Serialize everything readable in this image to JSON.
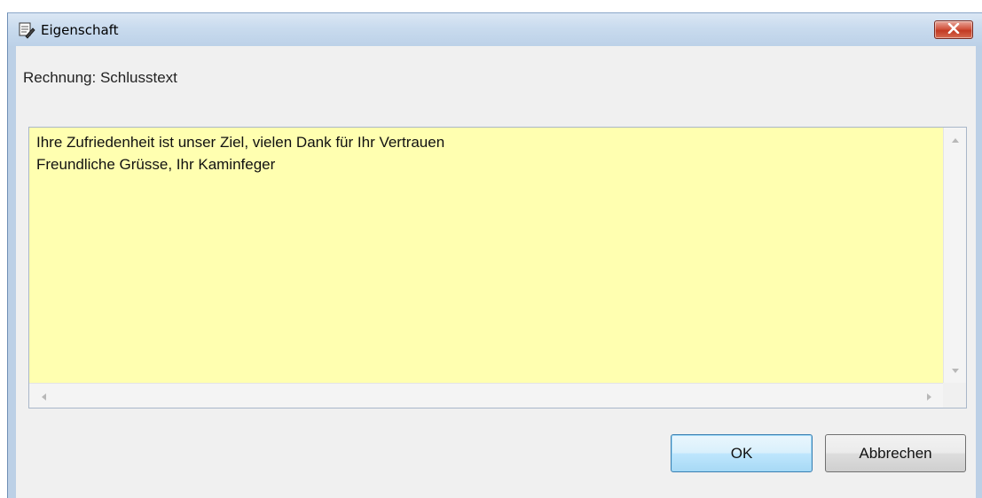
{
  "window": {
    "title": "Eigenschaft",
    "icon": "app-pen-icon",
    "close_icon": "close-icon"
  },
  "property": {
    "label": "Rechnung: Schlusstext"
  },
  "editor": {
    "value": "Ihre Zufriedenheit ist unser Ziel, vielen Dank für Ihr Vertrauen\nFreundliche Grüsse, Ihr Kaminfeger",
    "background_color": "#ffffb0"
  },
  "buttons": {
    "ok_label": "OK",
    "cancel_label": "Abbrechen"
  },
  "colors": {
    "close_button": "#c74a33",
    "ok_border": "#3c7fb1"
  }
}
